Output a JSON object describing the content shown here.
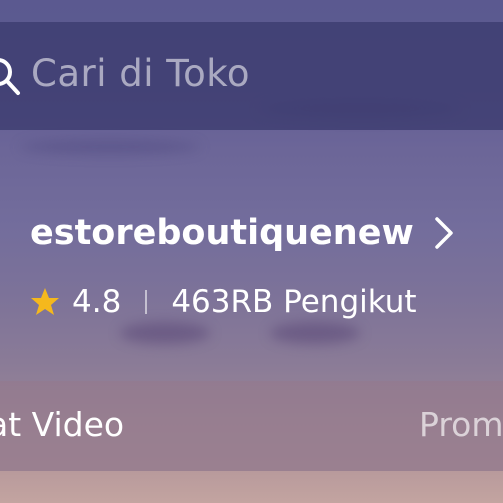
{
  "search": {
    "placeholder": "Cari di Toko",
    "icon": "search-icon"
  },
  "shop": {
    "name": "estoreboutiquenew",
    "rating": "4.8",
    "followers": "463RB Pengikut",
    "star_color": "#f5b81c"
  },
  "tabs": [
    {
      "label": "at Video"
    },
    {
      "label": "Prom"
    }
  ]
}
